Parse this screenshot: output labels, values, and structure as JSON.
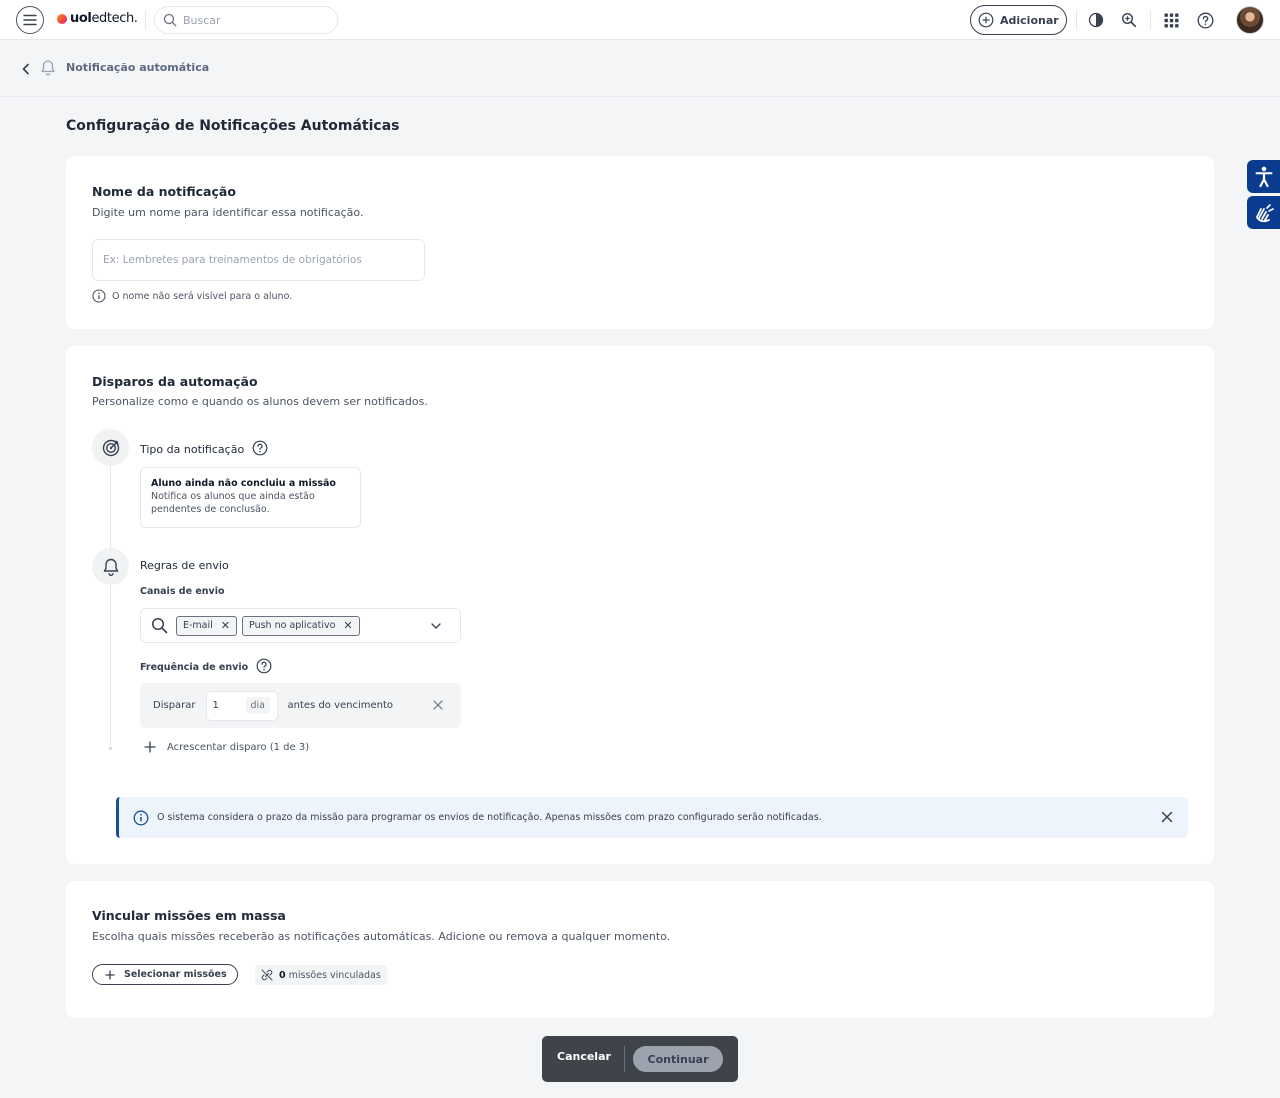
{
  "topbar": {
    "logo_brand": "uol",
    "logo_suffix": "edtech.",
    "search_placeholder": "Buscar",
    "add_label": "Adicionar"
  },
  "breadcrumb": {
    "title": "Notificação automática"
  },
  "page": {
    "title": "Configuração de Notificações Automáticas"
  },
  "name_section": {
    "title": "Nome da notificação",
    "subtitle": "Digite um nome para identificar essa notificação.",
    "input_value": "",
    "input_placeholder": "Ex: Lembretes para treinamentos de obrigatórios",
    "hint": "O nome não será visível para o aluno."
  },
  "triggers_section": {
    "title": "Disparos da automação",
    "subtitle": "Personalize como e quando os alunos devem ser notificados.",
    "type": {
      "label": "Tipo da notificação",
      "option_title": "Aluno ainda não concluiu a missão",
      "option_desc": "Notifica os alunos que ainda estão pendentes de conclusão."
    },
    "rules": {
      "label": "Regras de envio",
      "channels_label": "Canais de envio",
      "channels": [
        {
          "label": "E-mail"
        },
        {
          "label": "Push no aplicativo"
        }
      ],
      "frequency_label": "Frequência de envio",
      "frequency": {
        "prefix": "Disparar",
        "value": "1",
        "unit": "dia",
        "suffix": "antes do vencimento"
      },
      "add_trigger": "Acrescentar disparo (1 de 3)"
    },
    "banner": "O sistema considera o prazo da missão para programar os envios de notificação. Apenas missões com prazo configurado serão notificadas."
  },
  "missions_section": {
    "title": "Vincular missões em massa",
    "subtitle": "Escolha quais missões receberão as notificações automáticas. Adicione ou remova a qualquer momento.",
    "select_button": "Selecionar missões",
    "linked_count": "0",
    "linked_label": "missões vinculadas"
  },
  "footer": {
    "cancel": "Cancelar",
    "continue": "Continuar"
  },
  "colors": {
    "accent_dark": "#0b3b8f",
    "banner_bg": "#edf4fc",
    "banner_border": "#1f4e99",
    "footer_bg": "#3f444b"
  }
}
